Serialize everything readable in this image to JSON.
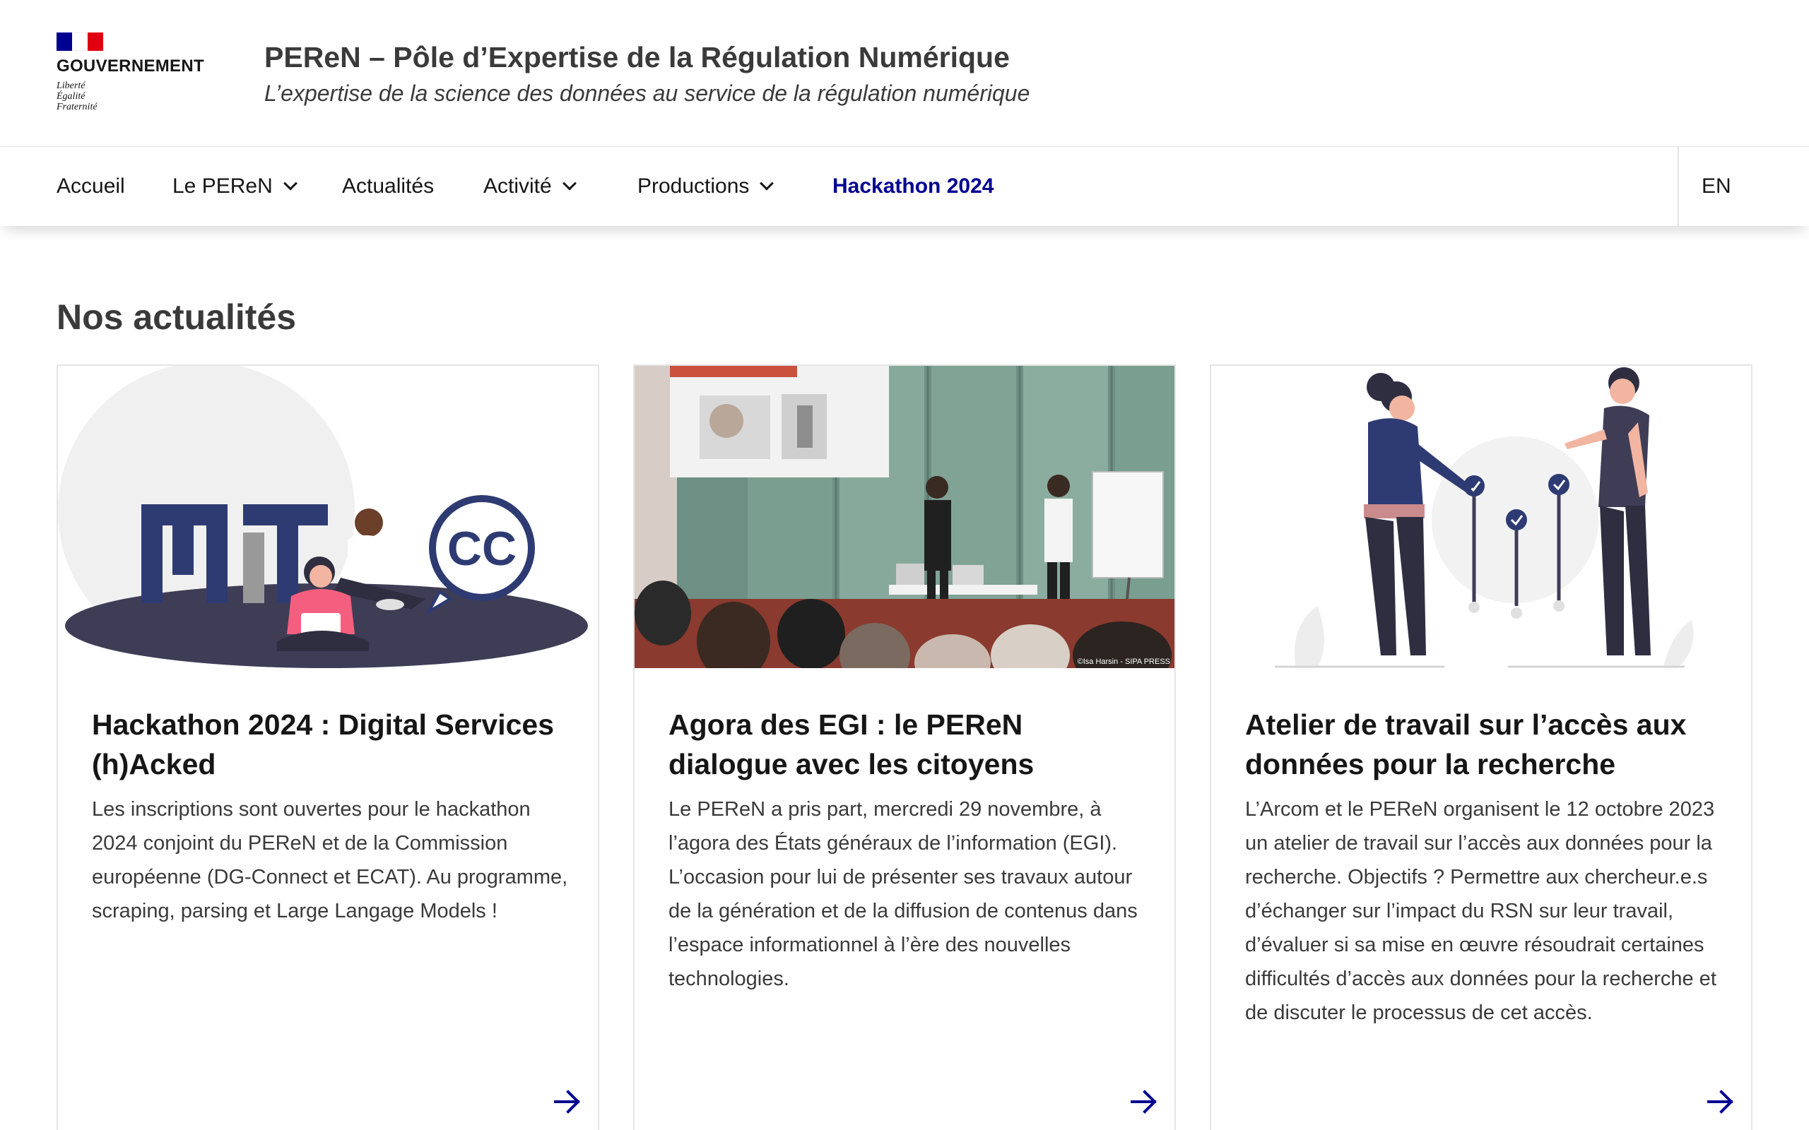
{
  "header": {
    "gov_name": "GOUVERNEMENT",
    "motto": [
      "Liberté",
      "Égalité",
      "Fraternité"
    ],
    "flag_colors": [
      "#000091",
      "#ffffff",
      "#e1000f"
    ],
    "site_title": "PEReN – Pôle d’Expertise de la Régulation Numérique",
    "site_tagline": "L’expertise de la science des données au service de la régulation numérique"
  },
  "nav": {
    "items": [
      {
        "label": "Accueil",
        "has_dropdown": false
      },
      {
        "label": "Le PEReN",
        "has_dropdown": true
      },
      {
        "label": "Actualités",
        "has_dropdown": false
      },
      {
        "label": "Activité",
        "has_dropdown": true
      },
      {
        "label": "Productions",
        "has_dropdown": true
      },
      {
        "label": "Hackathon 2024",
        "has_dropdown": false,
        "active": true
      }
    ],
    "lang": "EN",
    "active_color": "#000091"
  },
  "section": {
    "title": "Nos actualités"
  },
  "cards": [
    {
      "title": "Hackathon 2024 : Digital Services (h)Acked",
      "description": "Les inscriptions sont ouvertes pour le hackathon 2024 conjoint du PEReN et de la Commission européenne (DG-Connect et ECAT). Au programme, scraping, parsing et Large Langage Models !",
      "image_logo": "CC"
    },
    {
      "title": "Agora des EGI : le PEReN dialogue avec les citoyens",
      "description": "Le PEReN a pris part, mercredi 29 novembre, à l’agora des États généraux de l’information (EGI). L’occasion pour lui de présenter ses travaux autour de la génération et de la diffusion de contenus dans l’espace informationnel à l’ère des nouvelles technologies.",
      "image_credit": "©Isa Harsin - SIPA PRESS"
    },
    {
      "title": "Atelier de travail sur l’accès aux données pour la recherche",
      "description": "L’Arcom et le PEReN organisent le 12 octobre 2023 un atelier de travail sur l’accès aux données pour la recherche. Objectifs ? Permettre aux chercheur.e.s d’échanger sur l’impact du RSN sur leur travail, d’évaluer si sa mise en œuvre résoudrait certaines difficultés d’accès aux données pour la recherche et de discuter le processus de cet accès."
    }
  ]
}
